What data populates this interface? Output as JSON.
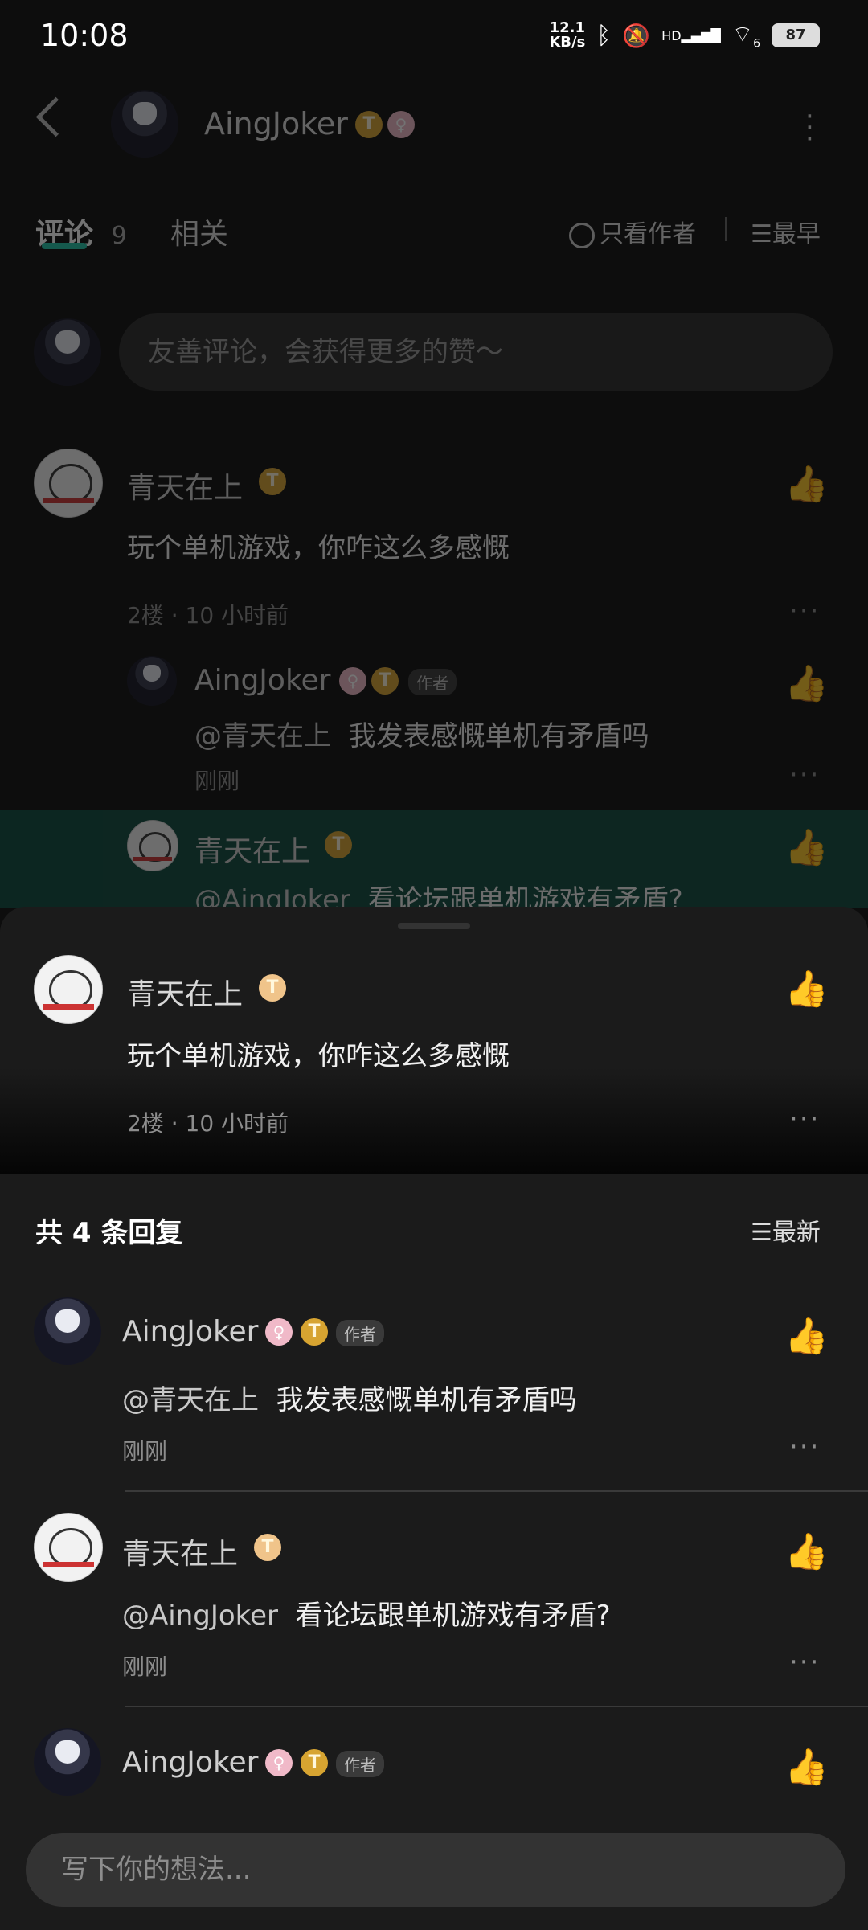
{
  "status": {
    "time": "10:08",
    "net_speed_top": "12.1",
    "net_speed_bottom": "KB/s",
    "hd": "HD",
    "wifi_num": "6",
    "battery": "87"
  },
  "header": {
    "user": "AingJoker"
  },
  "tabs": {
    "comments_label": "评论",
    "comments_count": "9",
    "related_label": "相关",
    "only_author": "只看作者",
    "sort": "最早"
  },
  "comment_input_placeholder": "友善评论，会获得更多的赞～",
  "bg_comment": {
    "name": "青天在上",
    "text": "玩个单机游戏，你咋这么多感慨",
    "meta": "2楼 · 10 小时前"
  },
  "bg_reply1": {
    "name": "AingJoker",
    "tag": "作者",
    "mention": "@青天在上",
    "text": "我发表感慨单机有矛盾吗",
    "meta": "刚刚"
  },
  "bg_reply2": {
    "name": "青天在上",
    "mention": "@AingJoker",
    "text": "看论坛跟单机游戏有矛盾?"
  },
  "focus_comment": {
    "name": "青天在上",
    "text": "玩个单机游戏，你咋这么多感慨",
    "meta": "2楼 · 10 小时前"
  },
  "replies_header": {
    "title": "共 4 条回复",
    "sort": "最新"
  },
  "replies": [
    {
      "name": "AingJoker",
      "tag": "作者",
      "mention": "@青天在上",
      "text": "我发表感慨单机有矛盾吗",
      "meta": "刚刚"
    },
    {
      "name": "青天在上",
      "mention": "@AingJoker",
      "text": "看论坛跟单机游戏有矛盾?",
      "meta": "刚刚"
    },
    {
      "name": "AingJoker",
      "tag": "作者"
    }
  ],
  "bottom_input_placeholder": "写下你的想法...",
  "badges": {
    "t": "T",
    "pink": "♀"
  }
}
